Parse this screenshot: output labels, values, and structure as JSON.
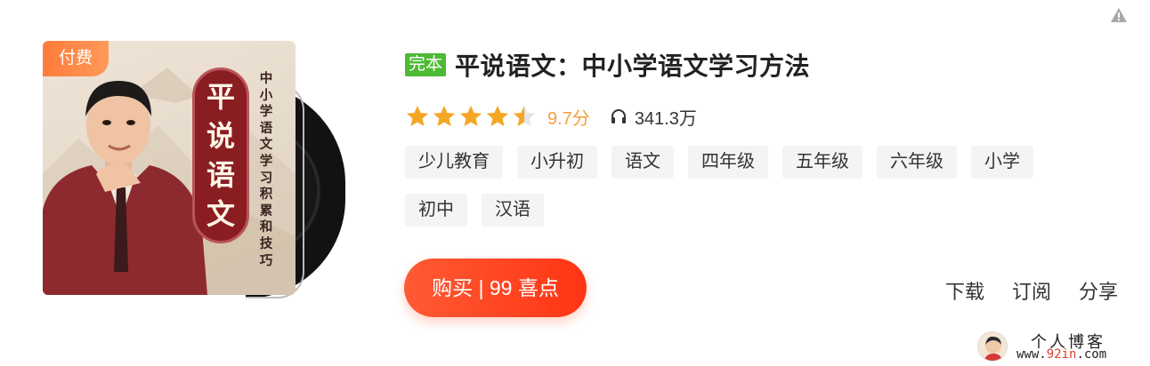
{
  "page": {
    "warning_icon": "warning-triangle-icon"
  },
  "cover": {
    "badge_label": "付费",
    "seal_chars": [
      "平",
      "说",
      "语",
      "文"
    ],
    "vertical_text": [
      "中",
      "小",
      "学",
      "语",
      "文",
      "学",
      "习",
      "积",
      "累",
      "和",
      "技",
      "巧"
    ]
  },
  "book": {
    "status_badge": "完本",
    "title": "平说语文：中小学语文学习方法",
    "rating_stars": 4.5,
    "score": "9.7分",
    "listens_icon": "headphone-icon",
    "listens": "341.3万"
  },
  "tags": [
    "少儿教育",
    "小升初",
    "语文",
    "四年级",
    "五年级",
    "六年级",
    "小学",
    "初中",
    "汉语"
  ],
  "buy_button": {
    "label": "购买 | 99 喜点"
  },
  "actions": {
    "download": "下载",
    "subscribe": "订阅",
    "share": "分享"
  },
  "watermark": {
    "line1": "个人博客",
    "line2_a": "www.",
    "line2_b": "92in",
    "line2_c": ".com"
  },
  "colors": {
    "accent_orange": "#ff4a22",
    "complete_green": "#4dba34",
    "score_orange": "#f2a03b",
    "star_orange": "#f5a623"
  }
}
